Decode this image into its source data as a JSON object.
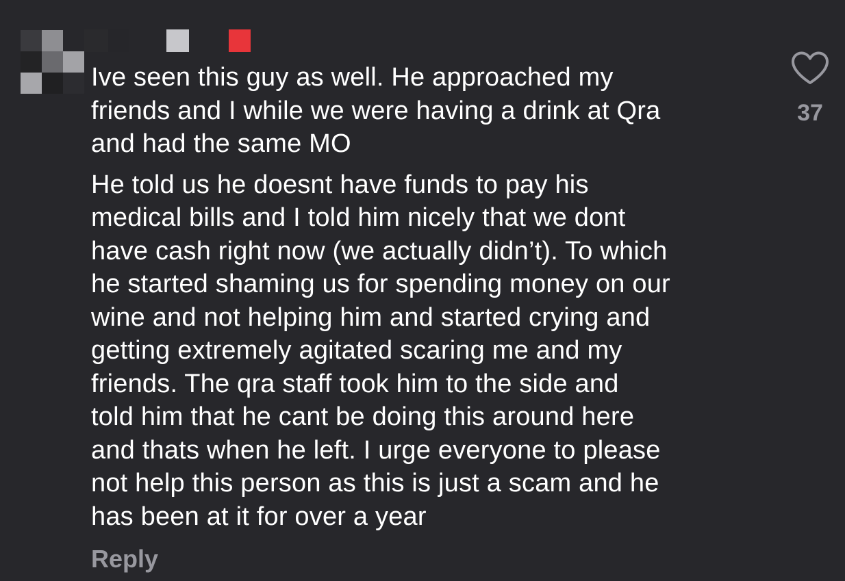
{
  "comment": {
    "paragraphs": [
      "Ive seen this guy as well. He approached my\nfriends and I while we were having a drink at Qra\nand had the same MO",
      "He told us he doesnt have funds to pay his\nmedical bills and I told him nicely that we dont\nhave cash right now (we actually didn’t). To which\nhe started shaming us for spending money on our\nwine and not helping him and started crying and\ngetting extremely agitated scaring me and my\nfriends. The qra staff took him to the side and\ntold him that he cant be doing this around here\nand thats when he left. I urge everyone to please\nnot help this person as this is just a scam and he\nhas been at it for over a year"
    ],
    "reply_label": "Reply",
    "like_count": "37",
    "like_icon": "heart-outline-icon"
  },
  "colors": {
    "background": "#27272b",
    "text": "#ffffff",
    "secondary_text": "#98989f"
  }
}
